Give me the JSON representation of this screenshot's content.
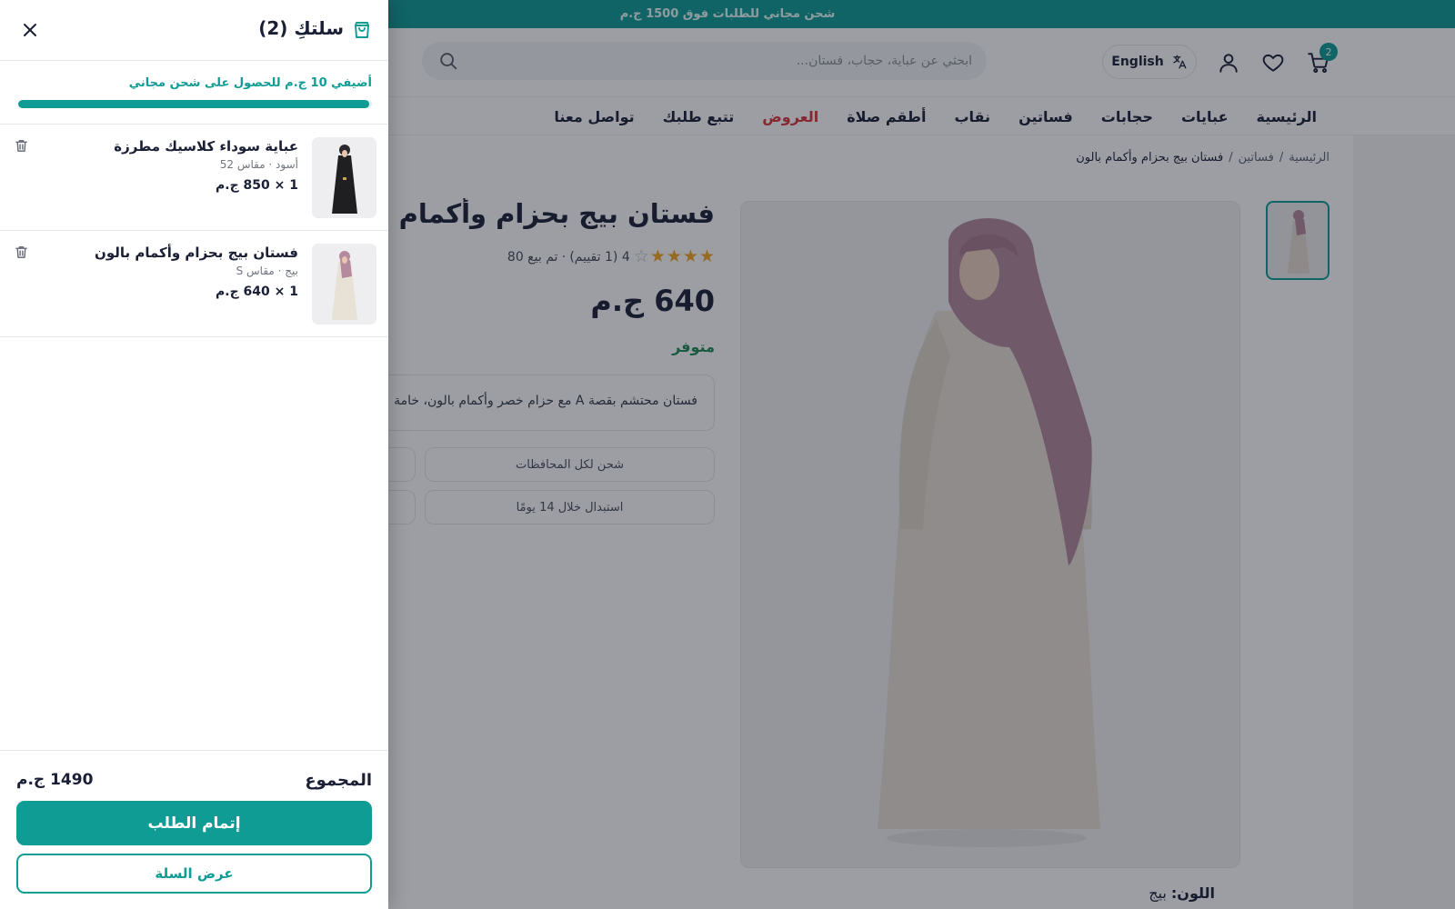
{
  "promo": {
    "text": "شحن مجاني للطلبات فوق 1500 ج.م"
  },
  "header": {
    "cart_count": "2",
    "language_label": "English",
    "search_placeholder": "ابحثي عن عباية، حجاب، فستان..."
  },
  "nav": {
    "items": [
      "الرئيسية",
      "عبايات",
      "حجابات",
      "فساتين",
      "نقاب",
      "أطقم صلاة",
      "العروض",
      "تتبع طلبك",
      "تواصل معنا"
    ]
  },
  "breadcrumb": {
    "home": "الرئيسية",
    "separator": "/",
    "category": "فساتين",
    "current": "فستان بيج بحزام وأكمام بالون"
  },
  "product": {
    "title": "فستان بيج بحزام وأكمام بالون",
    "rating": 4,
    "rating_text": "4 (1 تقييم)",
    "sold_text": "· تم بيع 80",
    "price": "640 ج.م",
    "stock": "متوفر",
    "description": "فستان محتشم بقصة A مع حزام خصر وأكمام بالون، خامة",
    "features": [
      "شحن لكل المحافظات",
      "استبدال خلال 14 يومًا"
    ],
    "color_label": "اللون:",
    "color_value": "بيج"
  },
  "cart_drawer": {
    "title": "سلتكِ (2)",
    "shipping_message": "أضيفي 10 ج.م للحصول على شحن مجاني",
    "shipping_progress": 0.993,
    "items": [
      {
        "name": "عباية سوداء كلاسيك مطرزة",
        "variant": "أسود · مقاس 52",
        "price": "1 × 850 ج.م"
      },
      {
        "name": "فستان بيج بحزام وأكمام بالون",
        "variant": "بيج · مقاس S",
        "price": "1 × 640 ج.م"
      }
    ],
    "total_label": "المجموع",
    "total_value": "1490 ج.م",
    "checkout_label": "إتمام الطلب",
    "view_cart_label": "عرض السلة"
  },
  "icons": [
    "cart-icon",
    "heart-icon",
    "user-icon",
    "translate-icon",
    "search-icon",
    "close-icon",
    "shopping-bag-icon",
    "trash-icon"
  ],
  "colors": {
    "primary": "#0f9c95",
    "sale": "#d8343a",
    "in_stock": "#1a8a55",
    "rating_star": "#f5a623"
  }
}
